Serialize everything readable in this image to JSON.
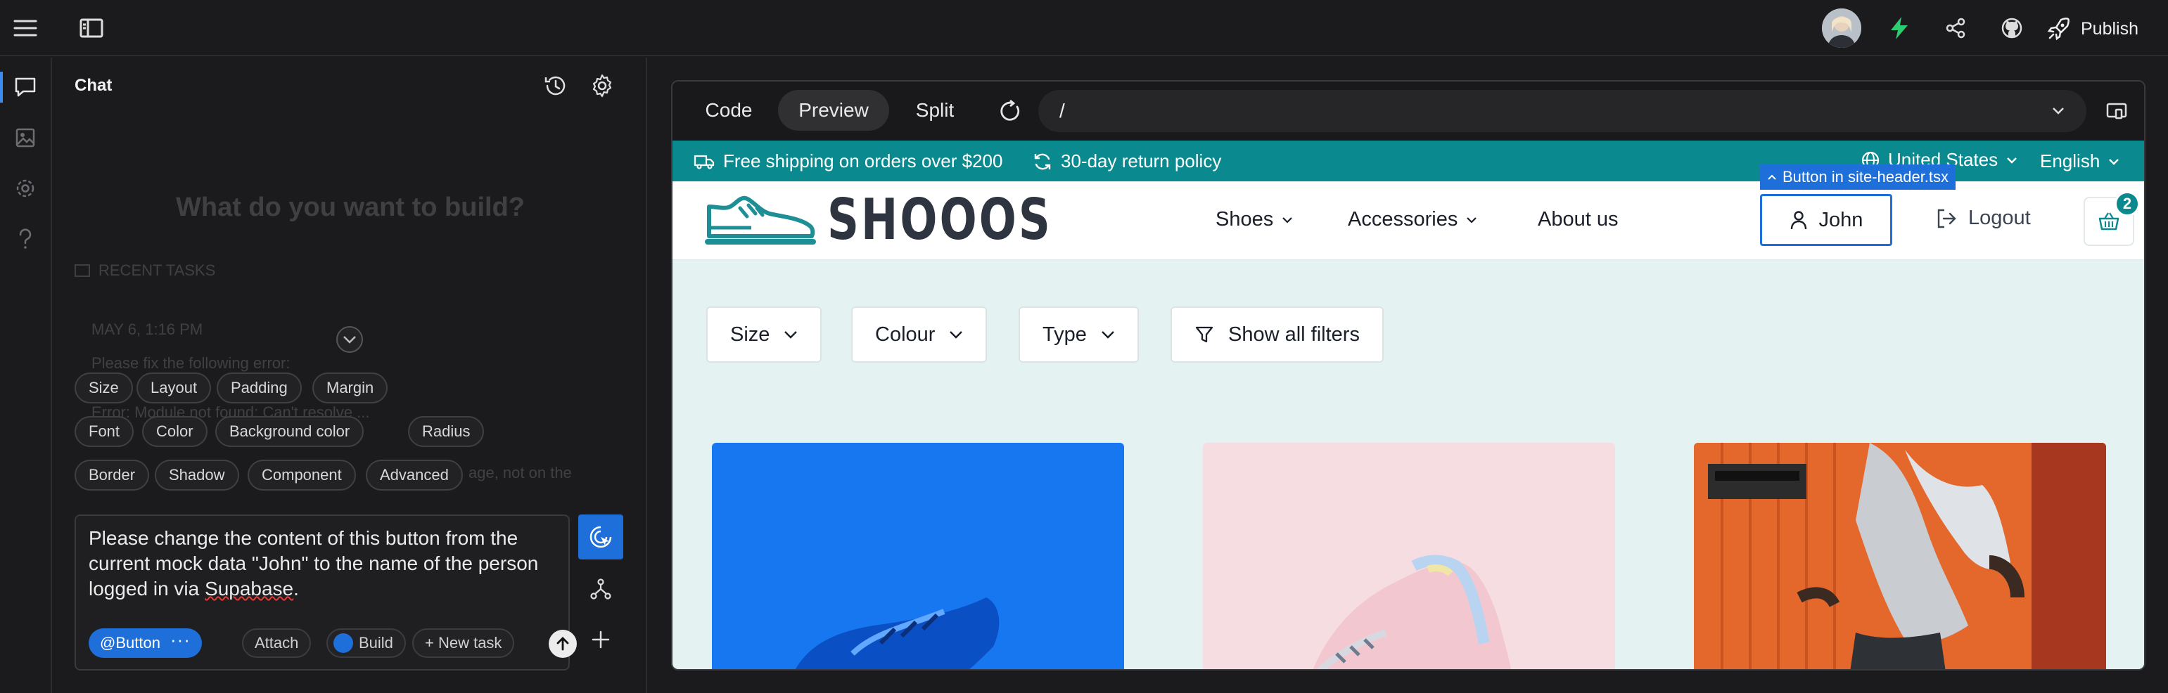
{
  "topbar": {
    "publish_label": "Publish"
  },
  "rail": {
    "items": [
      "chat",
      "image",
      "settings",
      "help"
    ]
  },
  "chat": {
    "title": "Chat",
    "background_heading": "What do you want to build?",
    "background_recent_label": "RECENT TASKS",
    "background_date": "MAY 6, 1:16 PM",
    "background_line1": "Please fix the following error:",
    "background_line2": "Error: Module not found: Can't resolve ...",
    "background_line3_tail": "age, not on the",
    "chips_row1": [
      "Size",
      "Layout",
      "Padding",
      "Margin"
    ],
    "chips_row2": [
      "Font",
      "Color",
      "Background color",
      "Radius"
    ],
    "chips_row3": [
      "Border",
      "Shadow",
      "Component",
      "Advanced"
    ],
    "composer": {
      "text_before": "Please change the content of this button from the current mock data \"John\" to the name of the person logged in via ",
      "text_misspelled": "Supabase",
      "text_after": ".",
      "button_tag": "@Button",
      "attach_label": "Attach",
      "build_label": "Build",
      "new_task_label": "+ New task"
    }
  },
  "preview": {
    "tabs": [
      "Code",
      "Preview",
      "Split"
    ],
    "active_tab": "Preview",
    "url": "/"
  },
  "site": {
    "announce": {
      "shipping": "Free shipping on orders over $200",
      "returns": "30-day return policy",
      "country": "United States",
      "language": "English"
    },
    "logo": "SHOOOS",
    "nav": [
      "Shoes",
      "Accessories",
      "About us"
    ],
    "user_button": "John",
    "logout": "Logout",
    "cart_count": "2",
    "hover_label": "Button in site-header.tsx",
    "filters": [
      "Size",
      "Colour",
      "Type",
      "Show all filters"
    ]
  },
  "colors": {
    "accent_blue": "#1e6fd9",
    "teal": "#0a8a8f",
    "site_bg": "#e4f3f2",
    "app_bg": "#1b1b1d"
  }
}
